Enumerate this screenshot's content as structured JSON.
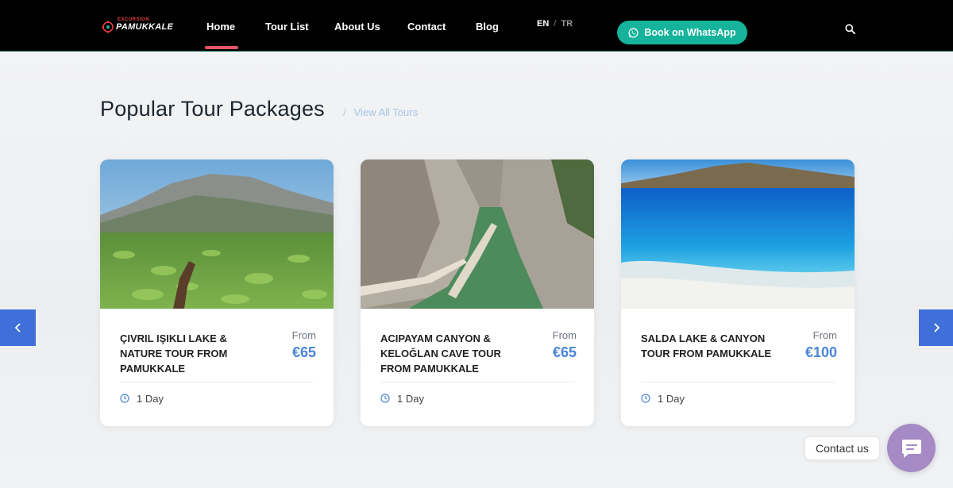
{
  "header": {
    "logo_small": "EXCURSION",
    "logo_main": "PAMUKKALE",
    "nav": [
      {
        "label": "Home",
        "active": true
      },
      {
        "label": "Tour List"
      },
      {
        "label": "About Us"
      },
      {
        "label": "Contact"
      },
      {
        "label": "Blog"
      }
    ],
    "lang_active": "EN",
    "lang_sep": "/",
    "lang_other": "TR",
    "whatsapp_label": "Book on WhatsApp",
    "icons": {
      "whatsapp": "whatsapp-icon",
      "search": "search-icon"
    }
  },
  "section": {
    "title": "Popular Tour Packages",
    "view_all_sep": "/",
    "view_all": "View All Tours"
  },
  "tours": [
    {
      "title": "ÇIVRIL IŞIKLI LAKE & NATURE TOUR FROM PAMUKKALE",
      "from": "From",
      "price": "€65",
      "duration": "1 Day"
    },
    {
      "title": "ACIPAYAM CANYON & KELOĞLAN CAVE TOUR FROM PAMUKKALE",
      "from": "From",
      "price": "€65",
      "duration": "1 Day"
    },
    {
      "title": "SALDA LAKE & CANYON TOUR FROM PAMUKKALE",
      "from": "From",
      "price": "€100",
      "duration": "1 Day"
    }
  ],
  "contact": {
    "label": "Contact us"
  },
  "colors": {
    "header_bg": "#000000",
    "accent_green": "#14b39a",
    "price_blue": "#4b86d6",
    "arrow_blue": "#3f6fd8",
    "nav_active": "#e5566a",
    "contact_purple": "#a58ac5"
  }
}
